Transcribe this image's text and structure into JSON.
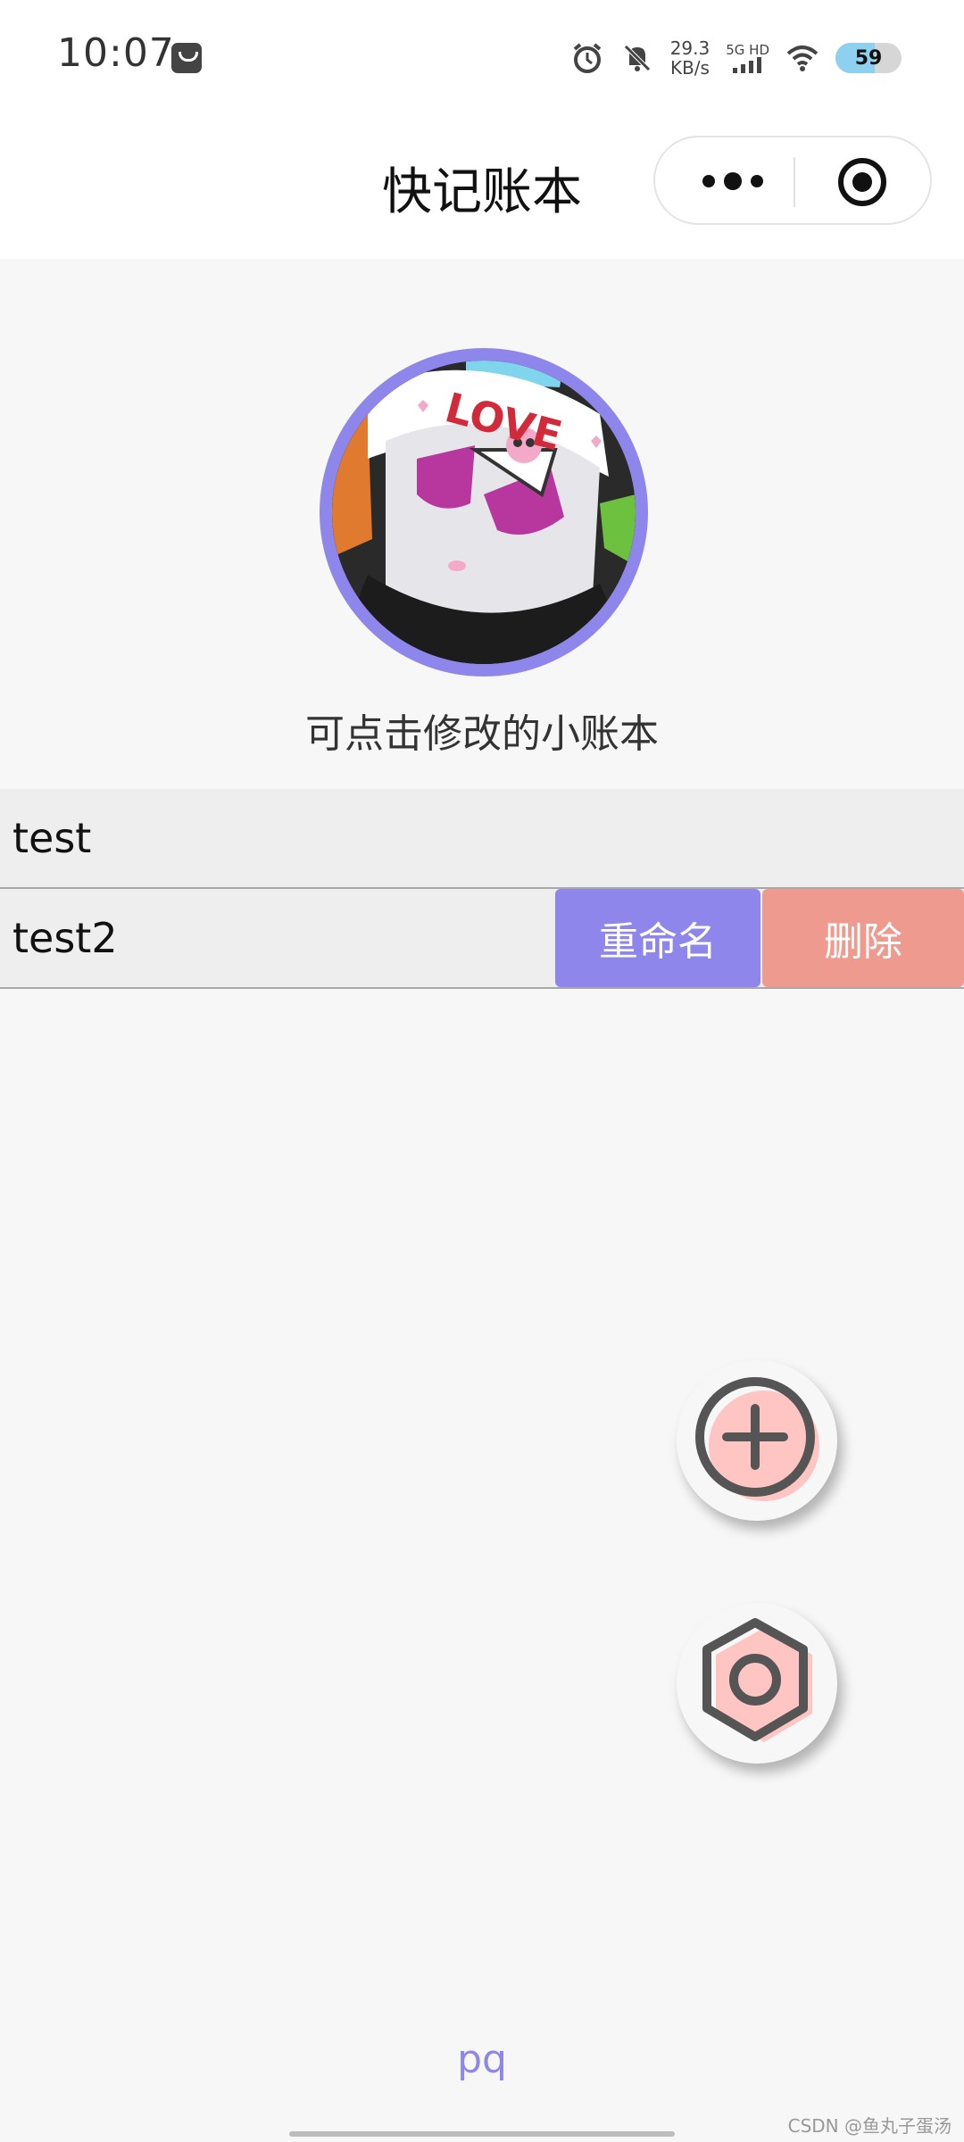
{
  "status_bar": {
    "time": "10:07",
    "net_speed_value": "29.3",
    "net_speed_unit": "KB/s",
    "network_label": "5G HD",
    "battery_level": "59",
    "battery_fraction": 0.59,
    "icons": [
      "message-icon",
      "alarm-icon",
      "mute-icon",
      "signal-icon",
      "wifi-icon",
      "battery-icon"
    ]
  },
  "nav": {
    "title": "快记账本",
    "capsule_icons": [
      "more-icon",
      "close-target-icon"
    ]
  },
  "profile": {
    "book_name": "可点击修改的小账本",
    "avatar_text": "LOVE"
  },
  "books": [
    {
      "label": "test"
    },
    {
      "label": "test2",
      "actions": {
        "rename": "重命名",
        "delete": "删除"
      }
    }
  ],
  "fabs": [
    {
      "icon": "add-icon"
    },
    {
      "icon": "settings-icon"
    }
  ],
  "footer": {
    "text": "pq"
  },
  "watermark": "CSDN @鱼丸子蛋汤",
  "colors": {
    "accent": "#8f86ec",
    "delete": "#ee9a8e",
    "fab_highlight": "#ffc5c2"
  }
}
